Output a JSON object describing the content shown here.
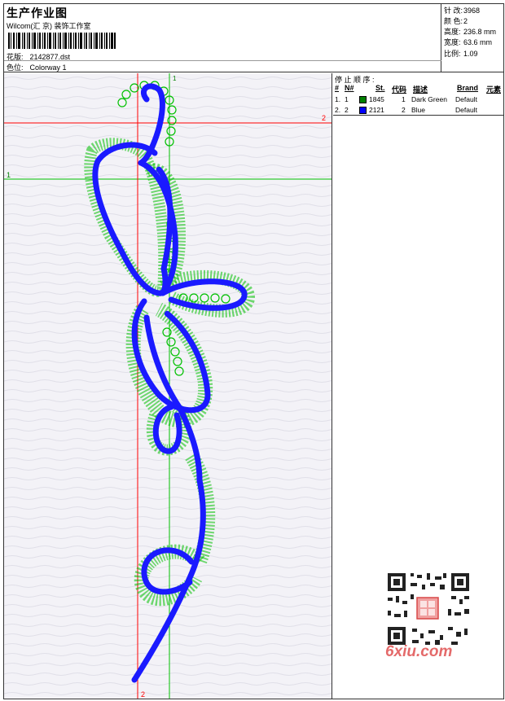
{
  "header": {
    "title": "生产作业图",
    "company": "Wilcom(汇 京) 装饰工作室",
    "design_label": "花版:",
    "design_value": "2142877.dst",
    "colorway_label": "色位:",
    "colorway_value": "Colorway 1"
  },
  "stats": {
    "stitches_label": "针 改:",
    "stitches_value": "3968",
    "colors_label": "颜 色:",
    "colors_value": "2",
    "height_label": "高度:",
    "height_value": "236.8 mm",
    "width_label": "宽度:",
    "width_value": "63.6 mm",
    "scale_label": "比例:",
    "scale_value": "1.09"
  },
  "stops": {
    "title": "停 止 顺 序 :",
    "col_num": "#",
    "col_no": "N#",
    "col_st": "St.",
    "col_code": "代码",
    "col_desc": "描述",
    "col_brand": "Brand",
    "col_elem": "元素",
    "rows": [
      {
        "num": "1.",
        "no": "1",
        "color": "#008000",
        "st": "1845",
        "code": "1",
        "desc": "Dark Green",
        "brand": "Default"
      },
      {
        "num": "2.",
        "no": "2",
        "color": "#0000ff",
        "st": "2121",
        "code": "2",
        "desc": "Blue",
        "brand": "Default"
      }
    ]
  },
  "guides": {
    "h1_label": "1",
    "h2_label": "2",
    "v1_label": "1",
    "v2_label": "2"
  },
  "watermark": {
    "site": "6xiu.com"
  },
  "colors": {
    "green": "#00c000",
    "blue": "#1a1aff",
    "red": "#ff0000",
    "dark_green": "#008000"
  }
}
